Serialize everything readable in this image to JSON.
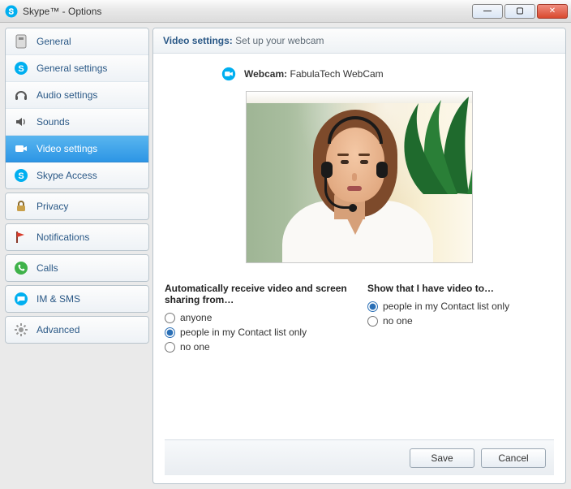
{
  "window": {
    "title": "Skype™ - Options"
  },
  "sidebar": {
    "groups": [
      {
        "header": "General",
        "icon": "category-general-icon",
        "items": [
          {
            "label": "General settings",
            "icon": "skype-icon",
            "selected": false
          },
          {
            "label": "Audio settings",
            "icon": "headphones-icon",
            "selected": false
          },
          {
            "label": "Sounds",
            "icon": "speaker-icon",
            "selected": false
          },
          {
            "label": "Video settings",
            "icon": "webcam-icon",
            "selected": true
          },
          {
            "label": "Skype Access",
            "icon": "skype-icon",
            "selected": false
          }
        ]
      },
      {
        "header": "Privacy",
        "icon": "lock-icon"
      },
      {
        "header": "Notifications",
        "icon": "flag-icon"
      },
      {
        "header": "Calls",
        "icon": "phone-icon"
      },
      {
        "header": "IM & SMS",
        "icon": "chat-icon"
      },
      {
        "header": "Advanced",
        "icon": "gear-icon"
      }
    ]
  },
  "panel": {
    "header_strong": "Video settings:",
    "header_rest": "Set up your webcam",
    "webcam_label": "Webcam:",
    "webcam_name": "FabulaTech WebCam"
  },
  "options": {
    "col1": {
      "title": "Automatically receive video and screen sharing from…",
      "items": [
        {
          "label": "anyone",
          "checked": false
        },
        {
          "label": "people in my Contact list only",
          "checked": true
        },
        {
          "label": "no one",
          "checked": false
        }
      ]
    },
    "col2": {
      "title": "Show that I have video to…",
      "items": [
        {
          "label": "people in my Contact list only",
          "checked": true
        },
        {
          "label": "no one",
          "checked": false
        }
      ]
    }
  },
  "buttons": {
    "save": "Save",
    "cancel": "Cancel"
  }
}
